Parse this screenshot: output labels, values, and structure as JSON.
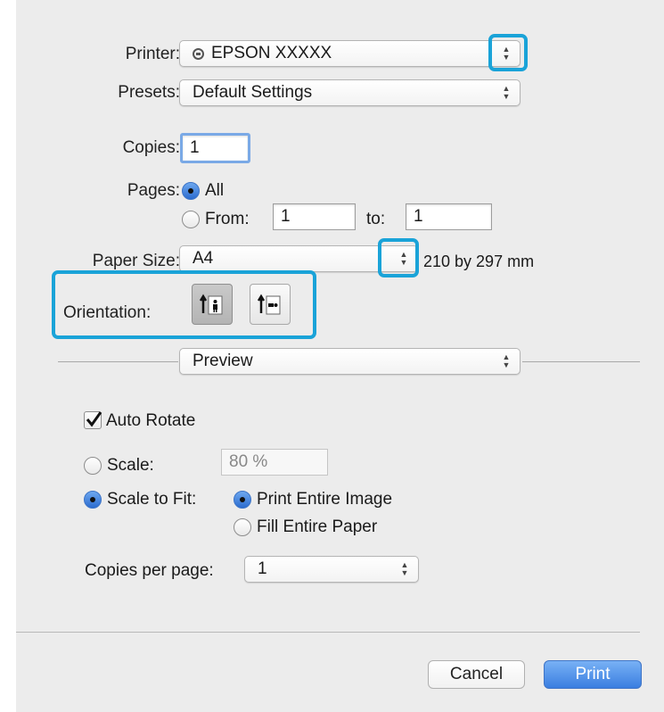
{
  "printer": {
    "label": "Printer:",
    "value": "EPSON XXXXX",
    "icon": "printer-status-icon"
  },
  "presets": {
    "label": "Presets:",
    "value": "Default Settings"
  },
  "copies": {
    "label": "Copies:",
    "value": "1"
  },
  "pages": {
    "label": "Pages:",
    "all_label": "All",
    "from_label": "From:",
    "from_value": "1",
    "to_label": "to:",
    "to_value": "1",
    "selected": "all"
  },
  "paper_size": {
    "label": "Paper Size:",
    "value": "A4",
    "dimensions": "210 by 297 mm"
  },
  "orientation": {
    "label": "Orientation:",
    "selected": "portrait",
    "options": [
      "portrait-icon",
      "landscape-icon"
    ]
  },
  "section_popup": {
    "value": "Preview"
  },
  "auto_rotate": {
    "label": "Auto Rotate",
    "checked": true
  },
  "scale": {
    "label": "Scale:",
    "value": "80 %"
  },
  "scale_to_fit": {
    "label": "Scale to Fit:",
    "print_entire_label": "Print Entire Image",
    "fill_entire_label": "Fill Entire Paper",
    "selected": "print_entire"
  },
  "copies_per_page": {
    "label": "Copies per page:",
    "value": "1"
  },
  "buttons": {
    "cancel": "Cancel",
    "print": "Print"
  },
  "colors": {
    "highlight": "#1aa3d8",
    "accent": "#3a7ee0",
    "dialog_bg": "#ececec"
  }
}
